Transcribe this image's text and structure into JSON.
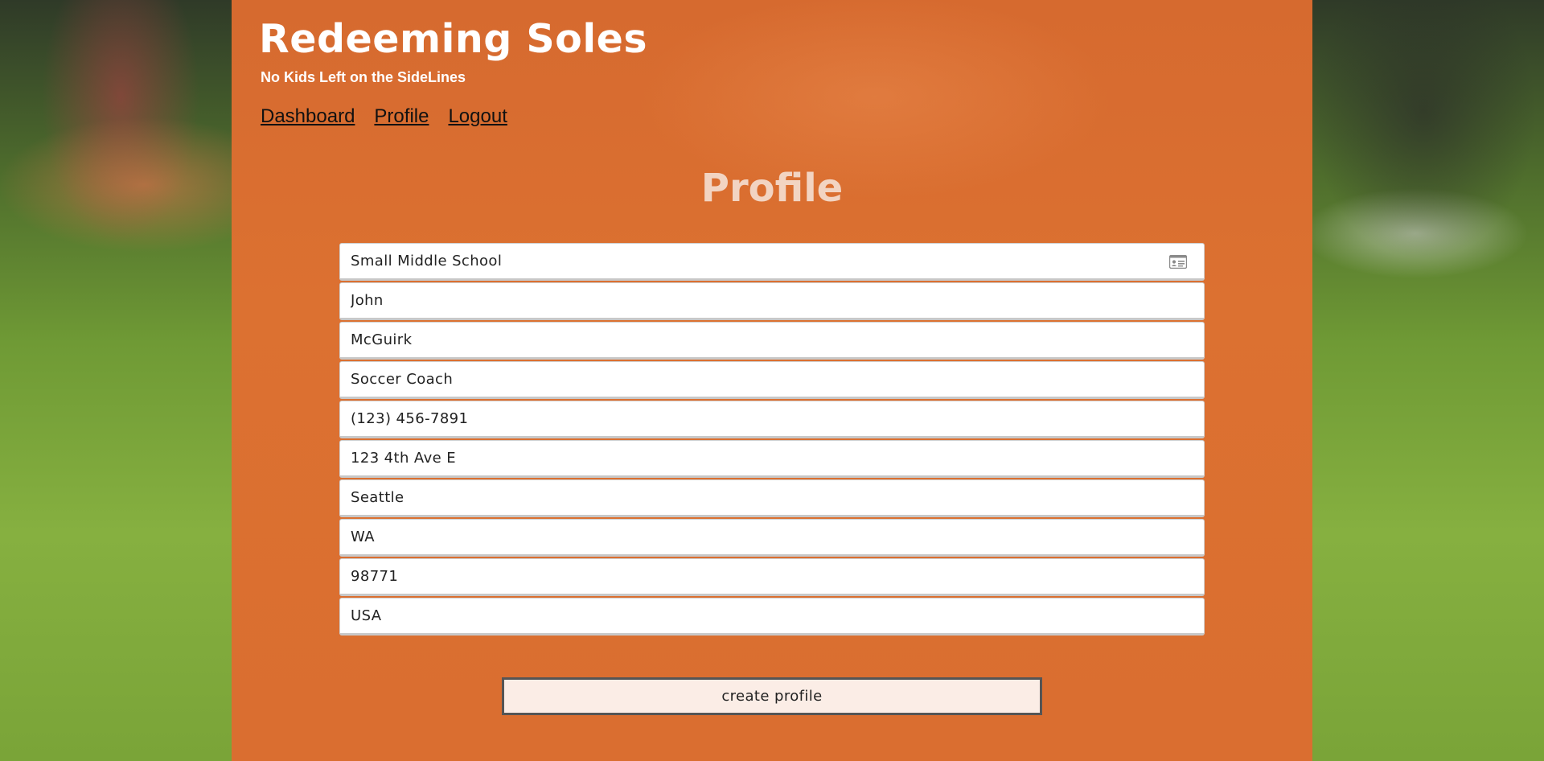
{
  "header": {
    "brand_title": "Redeeming Soles",
    "tagline": "No Kids Left on the SideLines"
  },
  "nav": {
    "items": [
      {
        "label": "Dashboard"
      },
      {
        "label": "Profile"
      },
      {
        "label": "Logout"
      }
    ]
  },
  "main": {
    "title": "Profile",
    "fields": [
      {
        "value": "Small Middle School",
        "icon": "contact-card-icon"
      },
      {
        "value": "John"
      },
      {
        "value": "McGuirk"
      },
      {
        "value": "Soccer Coach"
      },
      {
        "value": "(123) 456-7891"
      },
      {
        "value": "123 4th Ave E"
      },
      {
        "value": "Seattle"
      },
      {
        "value": "WA"
      },
      {
        "value": "98771"
      },
      {
        "value": "USA"
      }
    ],
    "submit_label": "create profile"
  },
  "colors": {
    "panel": "#da6e30",
    "title_text": "#f2d4c2",
    "button_bg": "#fbede6",
    "button_border": "#555555"
  }
}
